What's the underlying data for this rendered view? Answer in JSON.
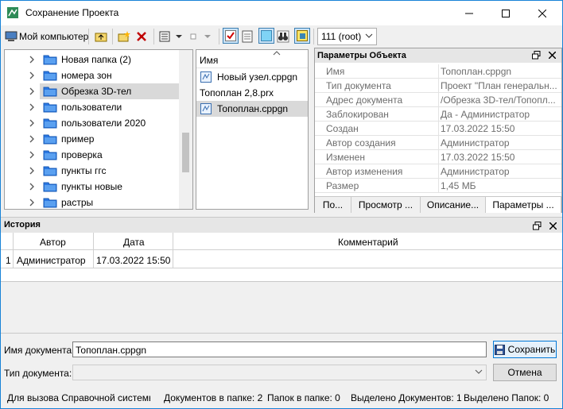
{
  "window": {
    "title": "Сохранение Проекта"
  },
  "toolbar": {
    "my_computer": "Мой компьютер",
    "root_combo": "111 (root)"
  },
  "tree": {
    "items": [
      {
        "label": "Новая папка (2)",
        "selected": false
      },
      {
        "label": "номера зон",
        "selected": false
      },
      {
        "label": "Обрезка 3D-тел",
        "selected": true
      },
      {
        "label": "пользователи",
        "selected": false
      },
      {
        "label": "пользователи 2020",
        "selected": false
      },
      {
        "label": "пример",
        "selected": false
      },
      {
        "label": "проверка",
        "selected": false
      },
      {
        "label": "пункты ггс",
        "selected": false
      },
      {
        "label": "пункты новые",
        "selected": false
      },
      {
        "label": "растры",
        "selected": false
      }
    ]
  },
  "files": {
    "header": "Имя",
    "items": [
      {
        "label": "Новый узел.cppgn",
        "icon": true,
        "selected": false
      },
      {
        "label": "Топоплан 2,8.prx",
        "icon": false,
        "selected": false
      },
      {
        "label": "Топоплан.cppgn",
        "icon": true,
        "selected": true
      }
    ]
  },
  "properties": {
    "title": "Параметры Объекта",
    "rows": [
      {
        "key": "Имя",
        "value": "Топоплан.cppgn"
      },
      {
        "key": "Тип документа",
        "value": "Проект \"План генеральн..."
      },
      {
        "key": "Адрес документа",
        "value": "/Обрезка 3D-тел/Топопл..."
      },
      {
        "key": "Заблокирован",
        "value": "Да - Администратор"
      },
      {
        "key": "Создан",
        "value": "17.03.2022 15:50"
      },
      {
        "key": "Автор создания",
        "value": "Администратор"
      },
      {
        "key": "Изменен",
        "value": "17.03.2022 15:50"
      },
      {
        "key": "Автор изменения",
        "value": "Администратор"
      },
      {
        "key": "Размер",
        "value": "1,45 МБ"
      }
    ],
    "tabs": [
      "По...",
      "Просмотр ...",
      "Описание...",
      "Параметры ..."
    ]
  },
  "history": {
    "title": "История",
    "columns": [
      "Автор",
      "Дата",
      "Комментарий"
    ],
    "rows": [
      {
        "num": "1",
        "author": "Администратор",
        "date": "17.03.2022 15:50",
        "comment": ""
      }
    ]
  },
  "form": {
    "doc_name_label": "Имя документа:",
    "doc_name_value": "Топоплан.cppgn",
    "doc_type_label": "Тип документа:",
    "doc_type_value": "",
    "save_label": "Сохранить",
    "cancel_label": "Отмена"
  },
  "statusbar": {
    "help": "Для вызова Справочной системы",
    "docs_in_folder": "Документов в папке: 2",
    "folders_in_folder": "Папок в папке: 0",
    "selected_docs": "Выделено Документов: 1",
    "selected_folders": "Выделено Папок: 0"
  },
  "colors": {
    "accent": "#1883d7",
    "folder": "#2b78e4",
    "selection": "#d9d9d9"
  }
}
